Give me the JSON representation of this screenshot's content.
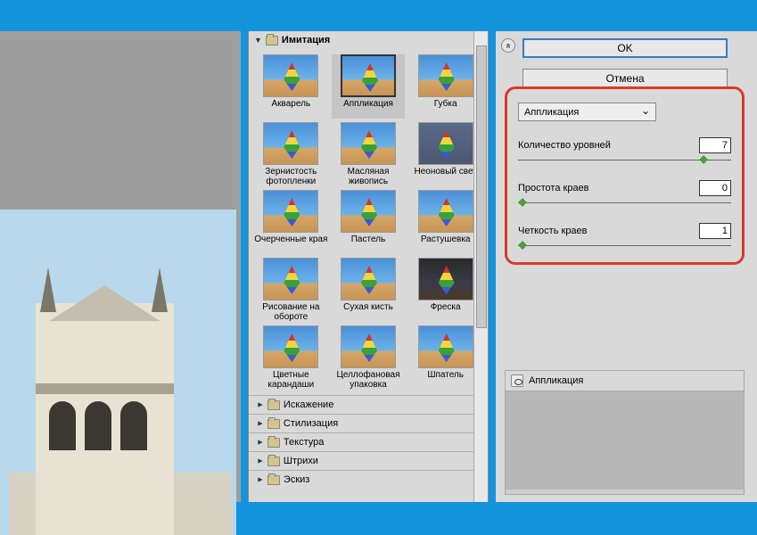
{
  "category_open": "Имитация",
  "filters": [
    {
      "label": "Акварель"
    },
    {
      "label": "Аппликация",
      "selected": true
    },
    {
      "label": "Губка"
    },
    {
      "label": "Зернистость фотопленки"
    },
    {
      "label": "Масляная живопись"
    },
    {
      "label": "Неоновый свет",
      "dark": true
    },
    {
      "label": "Очерченные края"
    },
    {
      "label": "Пастель"
    },
    {
      "label": "Растушевка"
    },
    {
      "label": "Рисование на обороте"
    },
    {
      "label": "Сухая кисть"
    },
    {
      "label": "Фреска",
      "fresco": true
    },
    {
      "label": "Цветные карандаши"
    },
    {
      "label": "Целлофановая упаковка"
    },
    {
      "label": "Шпатель"
    }
  ],
  "categories": [
    "Искажение",
    "Стилизация",
    "Текстура",
    "Штрихи",
    "Эскиз"
  ],
  "buttons": {
    "ok": "OK",
    "cancel": "Отмена"
  },
  "dropdown": "Аппликация",
  "params": [
    {
      "label": "Количество уровней",
      "value": "7",
      "pos": 85
    },
    {
      "label": "Простота краев",
      "value": "0",
      "pos": 0
    },
    {
      "label": "Четкость краев",
      "value": "1",
      "pos": 0
    }
  ],
  "effect_name": "Аппликация"
}
